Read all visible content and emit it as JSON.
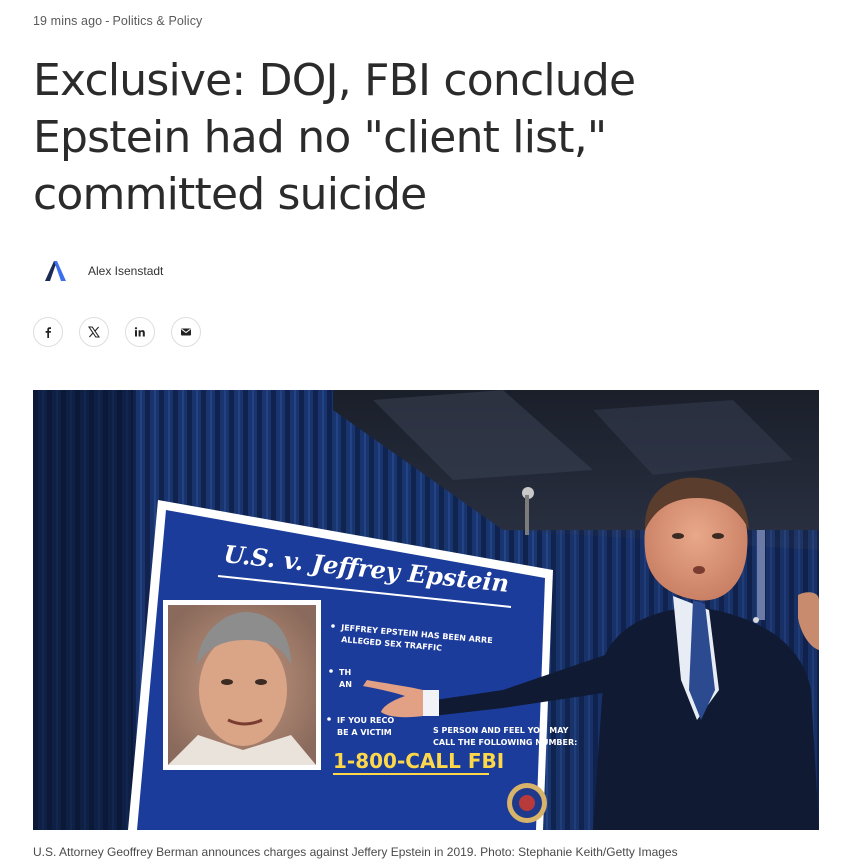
{
  "article": {
    "time": "19 mins ago",
    "separator": "-",
    "category": "Politics & Policy",
    "headline": "Exclusive: DOJ, FBI conclude Epstein had no \"client list,\" committed suicide",
    "author": "Alex Isenstadt",
    "caption": "U.S. Attorney Geoffrey Berman announces charges against Jeffery Epstein in 2019. Photo: Stephanie Keith/Getty Images"
  },
  "share": [
    {
      "icon": "facebook-icon",
      "glyph": "f"
    },
    {
      "icon": "x-icon",
      "glyph": "X"
    },
    {
      "icon": "linkedin-icon",
      "glyph": "in"
    },
    {
      "icon": "email-icon",
      "glyph": "mail"
    }
  ],
  "photo": {
    "sign_title": "U.S. v. Jeffrey Epstein",
    "bullet1_line1": "JEFFREY EPSTEIN HAS BEEN ARRE",
    "bullet1_line2": "ALLEGED SEX TRAFFIC",
    "bullet2_line1": "TH",
    "bullet2_line2": "AN",
    "bullet3_line1": "IF YOU RECO",
    "bullet3_line1b": "S PERSON AND FEEL YOU MAY",
    "bullet3_line2": "BE A VICTIM",
    "bullet3_line2b": "CALL THE FOLLOWING NUMBER:",
    "phone": "1-800-CALL FBI"
  },
  "colors": {
    "headline": "#2b2b2b",
    "meta": "#5a5a5a",
    "sign_blue": "#1c3c9b",
    "logo_dark": "#1b2a52",
    "logo_blue": "#3d6ef0"
  }
}
